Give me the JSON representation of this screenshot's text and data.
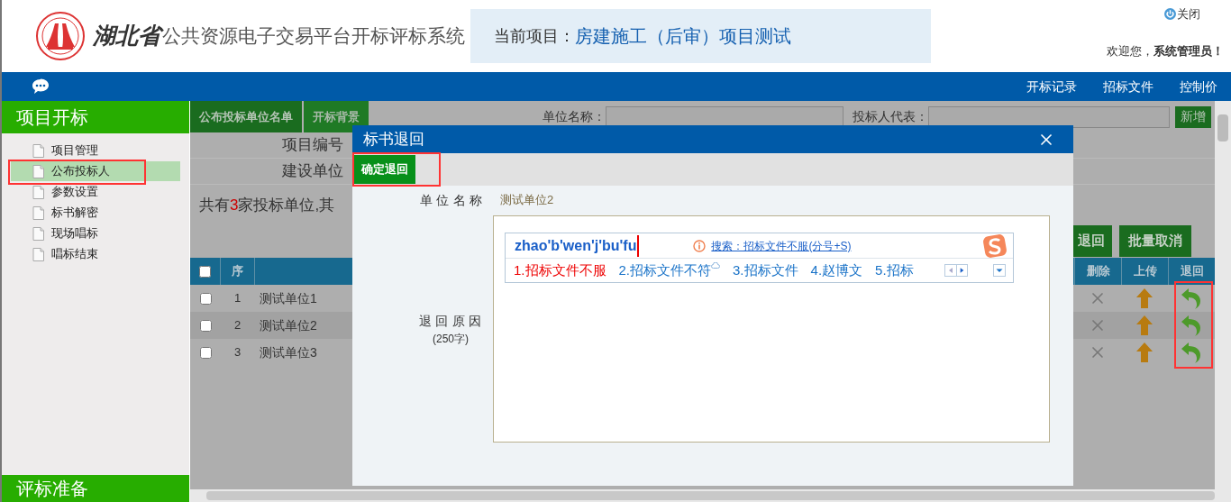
{
  "header": {
    "brand": "湖北省",
    "title": "公共资源电子交易平台开标评标系统",
    "project_label": "当前项目：",
    "project_name": "房建施工（后审）项目测试",
    "close": "关闭",
    "welcome": "欢迎您，",
    "user": "系统管理员！"
  },
  "nav": [
    "开标记录",
    "招标文件",
    "控制价"
  ],
  "sidebar": {
    "section": "项目开标",
    "items": [
      {
        "label": "项目管理",
        "selected": false,
        "highlighted": false
      },
      {
        "label": "公布投标人",
        "selected": true,
        "highlighted": true
      },
      {
        "label": "参数设置",
        "selected": false,
        "highlighted": false
      },
      {
        "label": "标书解密",
        "selected": false,
        "highlighted": false
      },
      {
        "label": "现场唱标",
        "selected": false,
        "highlighted": false
      },
      {
        "label": "唱标结束",
        "selected": false,
        "highlighted": false
      }
    ],
    "bottom_section": "评标准备"
  },
  "content": {
    "tabs": [
      {
        "label": "公布投标单位名单",
        "selected": true
      },
      {
        "label": "开标背景",
        "selected": false
      }
    ],
    "filters": [
      {
        "label": "单位名称："
      },
      {
        "label": "投标人代表："
      }
    ],
    "add_button": "新增",
    "info_rows": [
      "项目编号",
      "建设单位"
    ],
    "summary": {
      "before": "共有",
      "count": "3",
      "after": "家投标单位,其"
    },
    "actions": [
      "退回",
      "批量取消"
    ],
    "table": {
      "header_checked": false,
      "columns": [
        "序",
        "删除",
        "上传",
        "退回"
      ],
      "return_highlighted": true,
      "rows": [
        {
          "index": "1",
          "name": "测试单位1",
          "checked": false
        },
        {
          "index": "2",
          "name": "测试单位2",
          "checked": false
        },
        {
          "index": "3",
          "name": "测试单位3",
          "checked": false
        }
      ]
    }
  },
  "dialog": {
    "title": "标书退回",
    "confirm_button": "确定退回",
    "confirm_highlighted": true,
    "unit_label": "单位名称",
    "unit_value": "测试单位2",
    "reason_label": "退回原因",
    "reason_hint": "(250字)",
    "ime": {
      "composition": "zhao'b'wen'j'bu'fu",
      "search_link": "搜索：招标文件不服(分号+S)",
      "candidates": [
        {
          "text": "1.招标文件不服",
          "selected": true,
          "cloud": false
        },
        {
          "text": "2.招标文件不符",
          "selected": false,
          "cloud": true
        },
        {
          "text": "3.招标文件",
          "selected": false,
          "cloud": false
        },
        {
          "text": "4.赵博文",
          "selected": false,
          "cloud": false
        },
        {
          "text": "5.招标",
          "selected": false,
          "cloud": false
        }
      ]
    }
  }
}
